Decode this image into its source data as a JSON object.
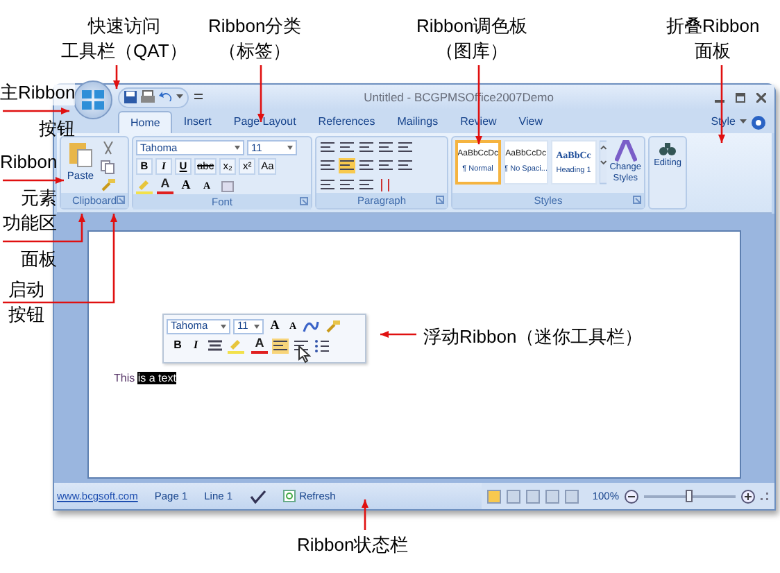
{
  "annotations": [
    {
      "lines": [
        "快速访问",
        "工具栏（QAT）"
      ]
    },
    {
      "lines": [
        "Ribbon分类",
        "（标签）"
      ]
    },
    {
      "lines": [
        "Ribbon调色板",
        "（图库）"
      ]
    },
    {
      "lines": [
        "折叠Ribbon",
        "面板"
      ]
    },
    {
      "lines": [
        "主Ribbon",
        "按钮"
      ]
    },
    {
      "lines": [
        "Ribbon",
        "元素"
      ]
    },
    {
      "lines": [
        "功能区",
        "面板"
      ]
    },
    {
      "lines": [
        "启动",
        "按钮"
      ]
    },
    {
      "lines": [
        "浮动Ribbon（迷你工具栏）"
      ]
    },
    {
      "lines": [
        "Ribbon状态栏"
      ]
    }
  ],
  "window": {
    "title": "Untitled - BCGPMSOffice2007Demo",
    "tabs": [
      {
        "label": "Home",
        "selected": true
      },
      {
        "label": "Insert",
        "selected": false
      },
      {
        "label": "Page Layout",
        "selected": false
      },
      {
        "label": "References",
        "selected": false
      },
      {
        "label": "Mailings",
        "selected": false
      },
      {
        "label": "Review",
        "selected": false
      },
      {
        "label": "View",
        "selected": false
      }
    ],
    "style_menu": "Style",
    "groups": {
      "clipboard": {
        "label": "Clipboard",
        "paste": "Paste"
      },
      "font": {
        "label": "Font",
        "font_name": "Tahoma",
        "font_size": "11",
        "buttons": [
          "B",
          "I",
          "U",
          "abc",
          "x₂",
          "x²",
          "Aa"
        ],
        "grow": "A",
        "shrink": "A",
        "color_button": "A"
      },
      "paragraph": {
        "label": "Paragraph"
      },
      "styles": {
        "label": "Styles",
        "gallery": [
          {
            "preview": "AaBbCcDc",
            "name": "¶ Normal",
            "selected": true
          },
          {
            "preview": "AaBbCcDc",
            "name": "¶ No Spaci...",
            "selected": false
          },
          {
            "preview": "AaBbCc",
            "name": "Heading 1",
            "selected": false
          }
        ],
        "change_styles": [
          "Change",
          "Styles"
        ]
      },
      "editing": {
        "button": "Editing"
      }
    },
    "mini_toolbar": {
      "font_name": "Tahoma",
      "font_size": "11",
      "grow": "A",
      "shrink": "A",
      "bold": "B",
      "italic": "I",
      "color_button": "A"
    },
    "document": {
      "text": "This",
      "selected_text": "is a text"
    },
    "status_bar": {
      "link": "www.bcgsoft.com",
      "page": "Page 1",
      "line": "Line 1",
      "refresh": "Refresh",
      "zoom": "100%",
      "zoom_slider": {
        "level": 0.5
      }
    }
  }
}
